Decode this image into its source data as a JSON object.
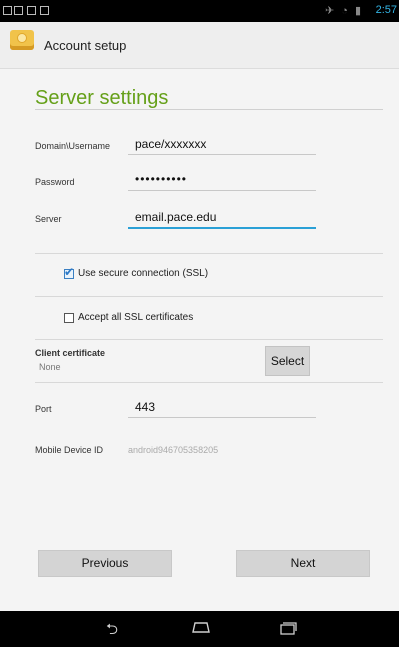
{
  "status_bar": {
    "time": "2:57"
  },
  "action_bar": {
    "title": "Account setup"
  },
  "server_settings": {
    "section_title": "Server settings",
    "domain_username": {
      "label": "Domain\\Username",
      "value": "pace/xxxxxxx"
    },
    "password": {
      "label": "Password",
      "masked_value": "••••••••••"
    },
    "server": {
      "label": "Server",
      "value": "email.pace.edu"
    },
    "use_ssl": {
      "label": "Use secure connection (SSL)",
      "checked": true
    },
    "accept_all_ssl": {
      "label": "Accept all SSL certificates",
      "checked": false
    },
    "client_certificate": {
      "label": "Client certificate",
      "value": "None",
      "select_label": "Select"
    },
    "port": {
      "label": "Port",
      "value": "443"
    },
    "mobile_device_id": {
      "label": "Mobile Device ID",
      "value": "android946705358205"
    }
  },
  "navigation": {
    "previous_label": "Previous",
    "next_label": "Next"
  },
  "system_nav": {
    "icons": [
      "back-icon",
      "home-icon",
      "recent-apps-icon"
    ]
  },
  "colors": {
    "section_title": "#65a019",
    "accent": "#2aa0d6",
    "status_time": "#33b5e5"
  }
}
